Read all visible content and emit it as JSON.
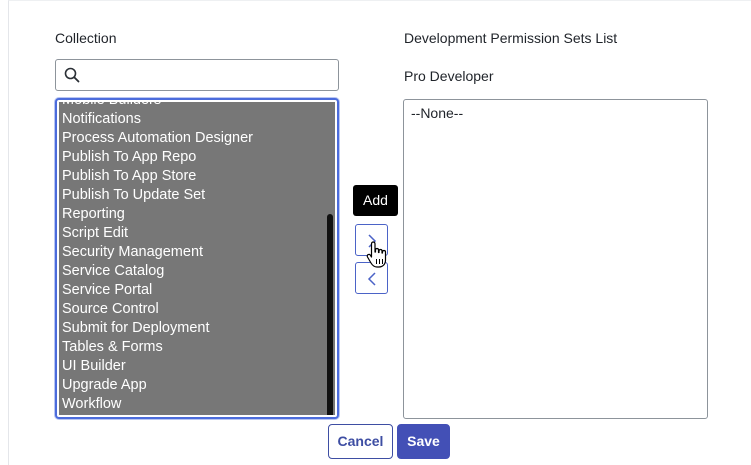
{
  "collection": {
    "label": "Collection",
    "search_value": "",
    "search_placeholder": "",
    "items": [
      "Mobile Builders",
      "Notifications",
      "Process Automation Designer",
      "Publish To App Repo",
      "Publish To App Store",
      "Publish To Update Set",
      "Reporting",
      "Script Edit",
      "Security Management",
      "Service Catalog",
      "Service Portal",
      "Source Control",
      "Submit for Deployment",
      "Tables & Forms",
      "UI Builder",
      "Upgrade App",
      "Workflow"
    ]
  },
  "slushbucket": {
    "add_tooltip": "Add",
    "add_icon": "chevron-right-icon",
    "remove_icon": "chevron-left-icon"
  },
  "permission_list": {
    "title": "Development Permission Sets List",
    "subtitle": "Pro Developer",
    "items": [
      "--None--"
    ]
  },
  "footer": {
    "cancel_label": "Cancel",
    "save_label": "Save"
  },
  "colors": {
    "accent": "#4350b6",
    "list_selected_bg": "#777777",
    "focus_border": "#4c6cdc"
  }
}
